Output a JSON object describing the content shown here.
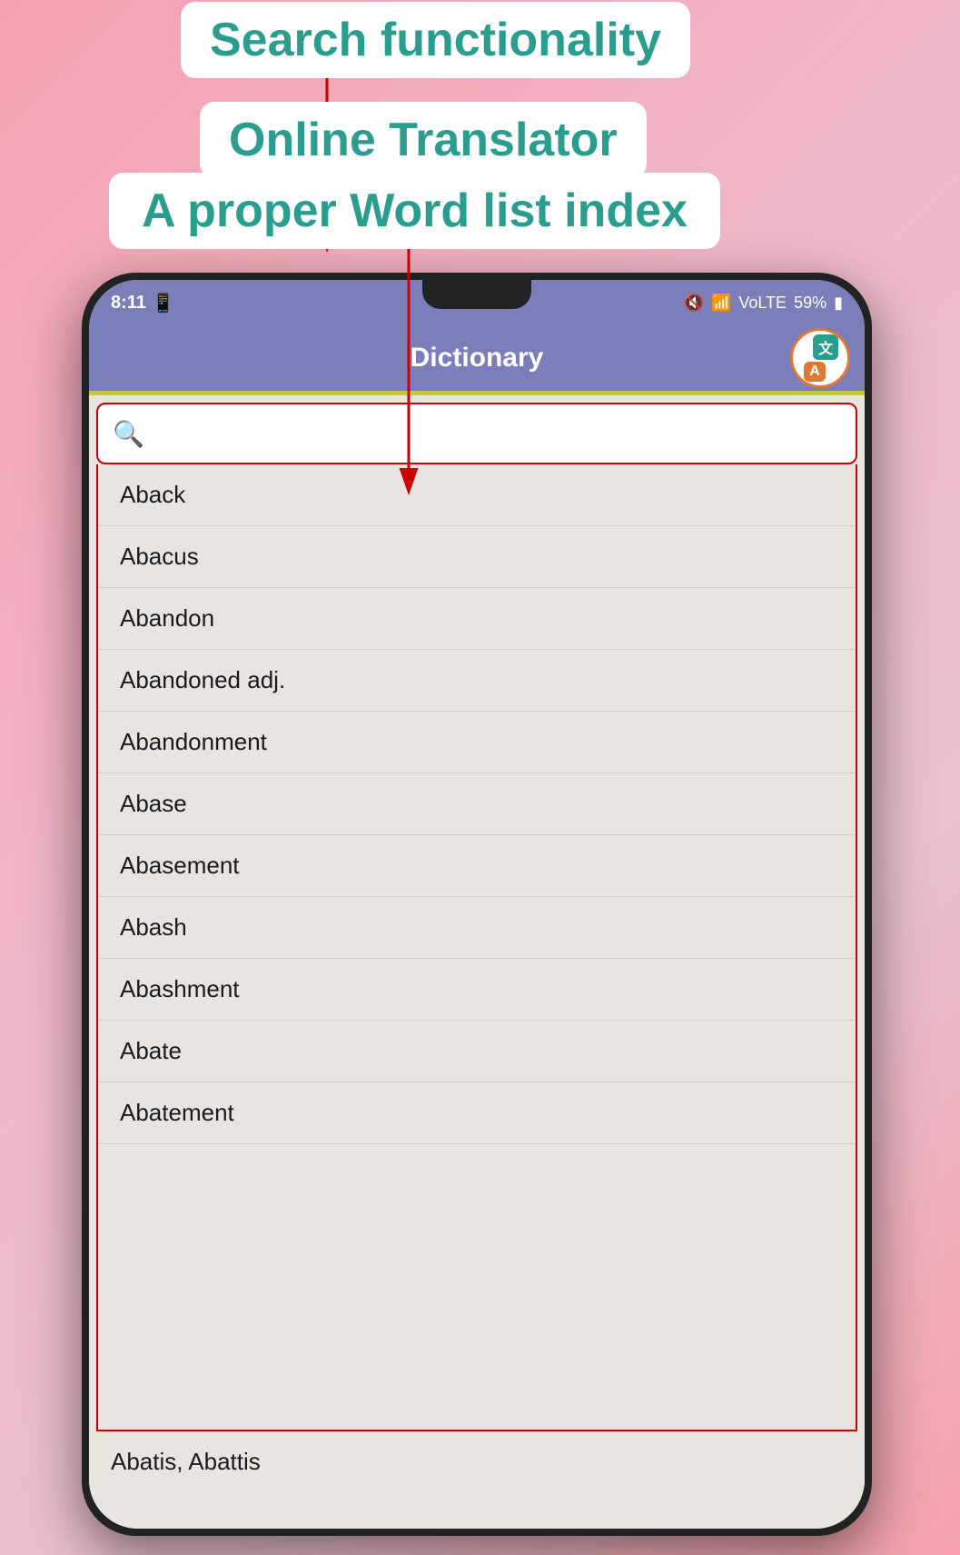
{
  "annotations": {
    "search_label": "Search functionality",
    "translator_label": "Online Translator",
    "wordlist_label": "A proper Word list index"
  },
  "status_bar": {
    "time": "8:11",
    "battery": "59%"
  },
  "app": {
    "title": "Dictionary",
    "translator_btn_top": "文",
    "translator_btn_bottom": "A"
  },
  "search": {
    "placeholder": ""
  },
  "word_list": [
    "Aback",
    "Abacus",
    "Abandon",
    "Abandoned adj.",
    "Abandonment",
    "Abase",
    "Abasement",
    "Abash",
    "Abashment",
    "Abate",
    "Abatement",
    "Abatis, Abattis"
  ]
}
